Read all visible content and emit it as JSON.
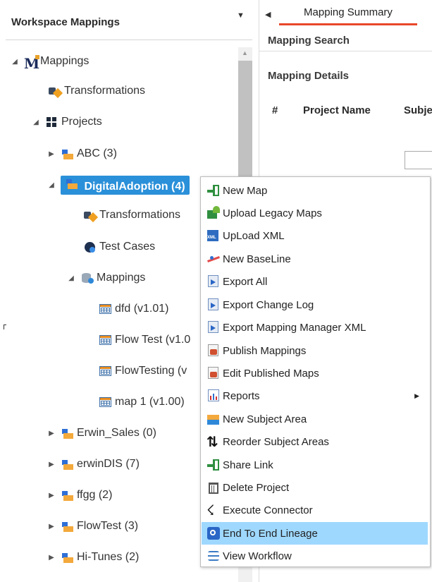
{
  "left_panel": {
    "title": "Workspace Mappings",
    "collapse_glyph": "▼"
  },
  "tree": {
    "root": {
      "label": "Mappings",
      "icon": "mapping-manager-icon",
      "toggle": "◢"
    },
    "transformations": {
      "label": "Transformations",
      "icon": "transformations-icon"
    },
    "projects": {
      "label": "Projects",
      "icon": "projects-grid-icon",
      "toggle": "◢"
    },
    "project_abc": {
      "label": "ABC (3)",
      "icon": "project-folder-icon",
      "toggle": "▶"
    },
    "project_digital": {
      "label": "DigitalAdoption (4)",
      "icon": "project-folder-icon",
      "toggle": "◢"
    },
    "digital_transformations": {
      "label": "Transformations",
      "icon": "transformations-icon"
    },
    "digital_test_cases": {
      "label": "Test Cases",
      "icon": "test-cases-gear-icon"
    },
    "digital_mappings": {
      "label": "Mappings",
      "icon": "mappings-db-icon",
      "toggle": "◢"
    },
    "map_dfd": {
      "label": "dfd (v1.01)",
      "icon": "map-table-icon"
    },
    "map_flowtest": {
      "label": "Flow Test (v1.0",
      "icon": "map-table-icon"
    },
    "map_flowtesting": {
      "label": "FlowTesting (v",
      "icon": "map-table-icon"
    },
    "map_map1": {
      "label": "map 1 (v1.00)",
      "icon": "map-table-icon"
    },
    "project_erwin_sales": {
      "label": "Erwin_Sales (0)",
      "icon": "project-folder-icon",
      "toggle": "▶"
    },
    "project_erwindis": {
      "label": "erwinDIS (7)",
      "icon": "project-folder-icon",
      "toggle": "▶"
    },
    "project_ffgg": {
      "label": "ffgg (2)",
      "icon": "project-folder-icon",
      "toggle": "▶"
    },
    "project_flowtest": {
      "label": "FlowTest (3)",
      "icon": "project-folder-icon",
      "toggle": "▶"
    },
    "project_hitunes": {
      "label": "Hi-Tunes (2)",
      "icon": "project-folder-icon",
      "toggle": "▶"
    }
  },
  "right_panel": {
    "prev_glyph": "◀",
    "tab_label": "Mapping Summary",
    "mapping_search": "Mapping Search",
    "mapping_details": "Mapping Details",
    "columns": [
      "#",
      "Project Name",
      "Subje"
    ]
  },
  "context_menu": {
    "items": [
      {
        "label": "New Map",
        "icon": "new-map-icon"
      },
      {
        "label": "Upload Legacy Maps",
        "icon": "upload-legacy-maps-icon"
      },
      {
        "label": "UpLoad XML",
        "icon": "upload-xml-icon"
      },
      {
        "label": "New BaseLine",
        "icon": "new-baseline-icon"
      },
      {
        "label": "Export All",
        "icon": "export-icon"
      },
      {
        "label": "Export Change Log",
        "icon": "export-icon"
      },
      {
        "label": "Export Mapping Manager XML",
        "icon": "export-icon"
      },
      {
        "label": "Publish Mappings",
        "icon": "publish-icon"
      },
      {
        "label": "Edit Published Maps",
        "icon": "publish-icon"
      },
      {
        "label": "Reports",
        "icon": "reports-icon",
        "submenu_glyph": "▶"
      },
      {
        "label": "New Subject Area",
        "icon": "subject-area-icon"
      },
      {
        "label": "Reorder Subject Areas",
        "icon": "reorder-arrows-icon"
      },
      {
        "label": "Share Link",
        "icon": "share-link-icon"
      },
      {
        "label": "Delete Project",
        "icon": "trash-icon"
      },
      {
        "label": "Execute Connector",
        "icon": "execute-runner-icon"
      },
      {
        "label": "End To End Lineage",
        "icon": "lineage-icon",
        "highlighted": true
      },
      {
        "label": "View Workflow",
        "icon": "workflow-icon"
      }
    ]
  },
  "colors": {
    "selection_blue": "#2a90d9",
    "menu_highlight": "#9fd8ff",
    "tab_underline": "#e8472a"
  }
}
